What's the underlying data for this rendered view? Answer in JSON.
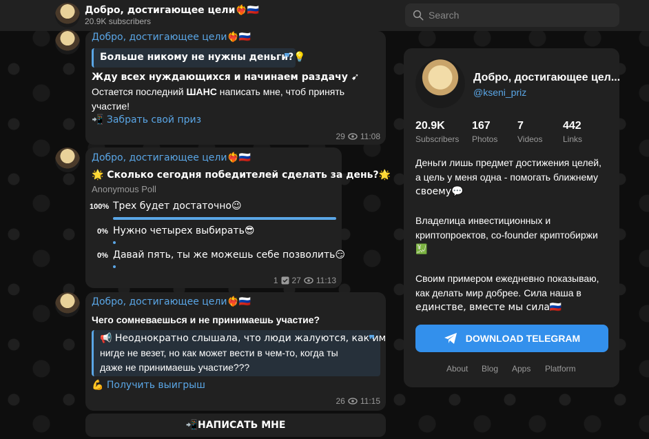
{
  "header": {
    "channel_title": "Добро, достигающее цели❤️‍🔥🇷🇺",
    "subscribers": "20.9K subscribers",
    "search_placeholder": "Search"
  },
  "messages": [
    {
      "sender": "Добро, достигающее цели❤️‍🔥🇷🇺",
      "quote": "Больше никому не нужны деньги?💡",
      "line1": "Жду всех нуждающихся и начинаем раздачу ➹",
      "line2_prefix": "Остается последний ",
      "line2_bold": "ШАНС",
      "line2_suffix": " написать мне, чтоб принять",
      "line3": "участие!",
      "link": "📲 Забрать свой приз",
      "views": "29",
      "time": "11:08"
    },
    {
      "sender": "Добро, достигающее цели❤️‍🔥🇷🇺",
      "poll_question": "🌟 Сколько сегодня победителей сделать за день?🌟",
      "poll_type": "Anonymous Poll",
      "options": [
        {
          "pct": "100%",
          "text": "Трех будет достаточно😉",
          "share": 1.0
        },
        {
          "pct": "0%",
          "text": "Нужно четырех выбирать😎",
          "share": 0.0
        },
        {
          "pct": "0%",
          "text": "Давай пять, ты же можешь себе позволить😏",
          "share": 0.0
        }
      ],
      "votes": "1",
      "views": "27",
      "time": "11:13"
    },
    {
      "sender": "Добро, достигающее цели❤️‍🔥🇷🇺",
      "headline": "Чего сомневаешься и не принимаешь участие?",
      "quote_line1": "📢 Неоднократно слышала, что люди жалуются, как им",
      "quote_line2": "нигде не везет, но как может вести в чем-то, когда ты",
      "quote_line3": "даже не принимаешь участие???",
      "link": "💪 Получить выигрыш",
      "views": "26",
      "time": "11:15"
    }
  ],
  "write_button": "📲НАПИСАТЬ МНЕ",
  "card": {
    "name": "Добро, достигающее цел...",
    "username": "@kseni_priz",
    "stats": [
      {
        "value": "20.9K",
        "label": "Subscribers"
      },
      {
        "value": "167",
        "label": "Photos"
      },
      {
        "value": "7",
        "label": "Videos"
      },
      {
        "value": "442",
        "label": "Links"
      }
    ],
    "desc1_line1": "Деньги лишь предмет достижения целей,",
    "desc1_line2": "а цель у меня одна - помогать ближнему",
    "desc1_line3": "своему💬",
    "desc2_line1": "Владелица инвестиционных и",
    "desc2_line2": "криптопроектов, co-founder криптобиржи",
    "desc2_line3": "💹",
    "desc3_line1": "Своим примером ежедневно показываю,",
    "desc3_line2": "как делать мир добрее. Сила наша в",
    "desc3_line3": "единстве, вместе мы сила🇷🇺",
    "download_label": "DOWNLOAD TELEGRAM",
    "footer": [
      "About",
      "Blog",
      "Apps",
      "Platform"
    ]
  },
  "colors": {
    "accent": "#3390ec",
    "link": "#5aa6e6",
    "bubble": "#212121"
  }
}
